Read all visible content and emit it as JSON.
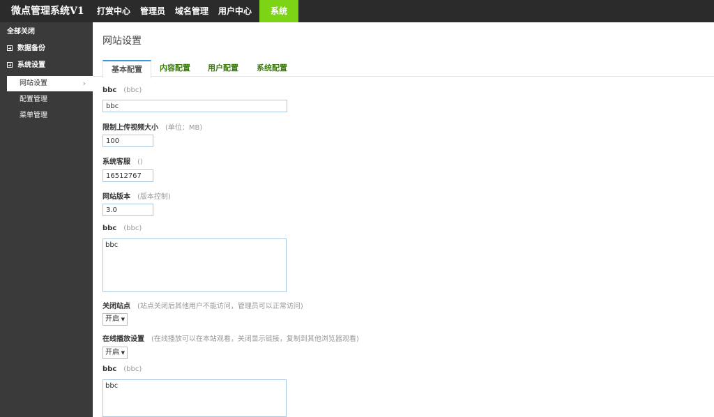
{
  "brand": "微点管理系统V1",
  "nav": [
    {
      "label": "打赏中心"
    },
    {
      "label": "管理员"
    },
    {
      "label": "域名管理"
    },
    {
      "label": "用户中心"
    },
    {
      "label": "系统"
    }
  ],
  "sidebar": {
    "collapse_all": "全部关闭",
    "groups": [
      {
        "label": "数据备份"
      },
      {
        "label": "系统设置"
      }
    ],
    "items": [
      {
        "label": "网站设置"
      },
      {
        "label": "配置管理"
      },
      {
        "label": "菜单管理"
      }
    ]
  },
  "page": {
    "title": "网站设置",
    "tabs": [
      {
        "label": "基本配置"
      },
      {
        "label": "内容配置"
      },
      {
        "label": "用户配置"
      },
      {
        "label": "系统配置"
      }
    ]
  },
  "form": {
    "f1": {
      "label": "bbc",
      "hint": "(bbc)",
      "value": "bbc"
    },
    "f2": {
      "label": "限制上传视频大小",
      "hint": "(单位：MB)",
      "value": "100"
    },
    "f3": {
      "label": "系统客服",
      "hint": "()",
      "value": "16512767"
    },
    "f4": {
      "label": "网站版本",
      "hint": "(版本控制)",
      "value": "3.0"
    },
    "f5": {
      "label": "bbc",
      "hint": "(bbc)",
      "value": "bbc"
    },
    "f6": {
      "label": "关闭站点",
      "hint": "(站点关闭后其他用户不能访问，管理员可以正常访问)",
      "value": "开启"
    },
    "f7": {
      "label": "在线播放设置",
      "hint": "(在线播放可以在本站观看，关闭显示链接，复制到其他浏览器观看)",
      "value": "开启"
    },
    "f8": {
      "label": "bbc",
      "hint": "(bbc)",
      "value": "bbc"
    }
  },
  "colors": {
    "topbar": "#2b2b2b",
    "sidebar": "#3a3a3a",
    "accent": "#7dd316",
    "tab_text": "#3a7d0a",
    "input_border": "#a9c7e0"
  }
}
